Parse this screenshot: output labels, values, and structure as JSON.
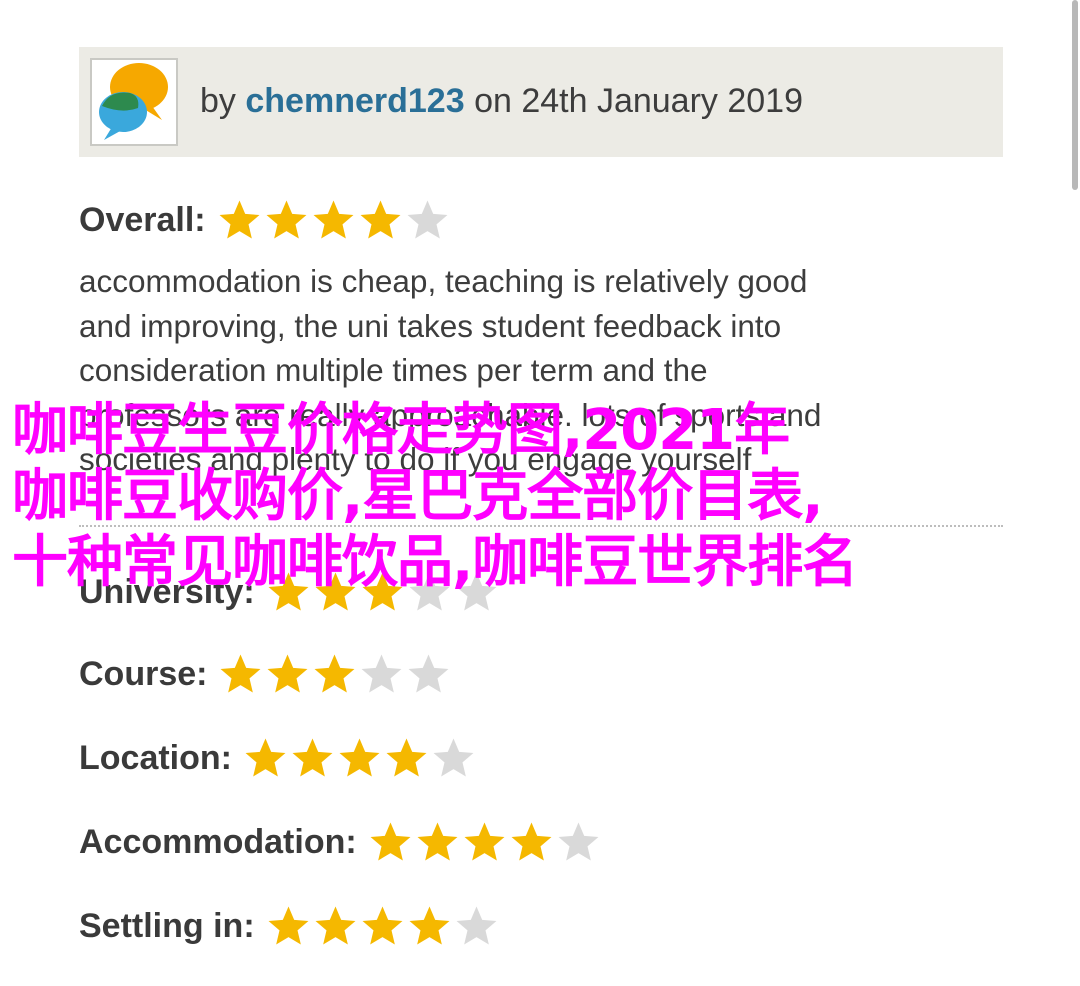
{
  "review": {
    "author_prefix": "by",
    "author": "chemnerd123",
    "date_text": "on 24th January 2019",
    "text_lines": [
      "accommodation is cheap, teaching is relatively good",
      "and improving, the uni takes student feedback into",
      "consideration multiple times per term and the",
      "professors are really approachable. lots of sports and",
      "societies and plenty to do if you engage yourself"
    ]
  },
  "ratings": [
    {
      "label": "Overall:",
      "stars": 4,
      "max": 5
    },
    {
      "label": "University:",
      "stars": 3,
      "max": 5
    },
    {
      "label": "Course:",
      "stars": 3,
      "max": 5
    },
    {
      "label": "Location:",
      "stars": 4,
      "max": 5
    },
    {
      "label": "Accommodation:",
      "stars": 4,
      "max": 5
    },
    {
      "label": "Settling in:",
      "stars": 4,
      "max": 5
    }
  ],
  "overlay_text": [
    "咖啡豆生豆价格走势图,2021年",
    "咖啡豆收购价,星巴克全部价目表,",
    "十种常见咖啡饮品,咖啡豆世界排名"
  ],
  "colors": {
    "star_filled": "#f5b800",
    "star_empty": "#d9d9d9",
    "author": "#2a6f97",
    "overlay": "#ff00ff",
    "header_bg": "#ecebe5"
  },
  "icons": {
    "avatar": "speech-bubbles-icon",
    "star": "star-icon"
  }
}
